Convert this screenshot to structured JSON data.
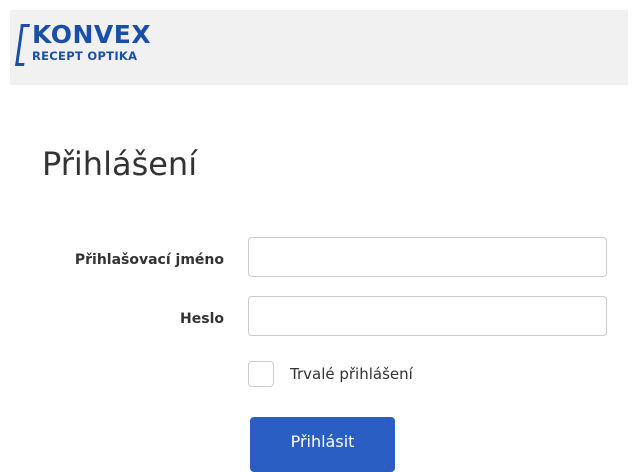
{
  "header": {
    "logo": {
      "brand": "KONVEX",
      "tagline": "RECEPT OPTIKA",
      "color": "#1a4fa8"
    }
  },
  "login": {
    "title": "Přihlášení",
    "username_label": "Přihlašovací jméno",
    "username_value": "",
    "password_label": "Heslo",
    "password_value": "",
    "remember_label": "Trvalé přihlášení",
    "remember_checked": false,
    "submit_label": "Přihlásit",
    "submit_color": "#2b5ec2"
  }
}
